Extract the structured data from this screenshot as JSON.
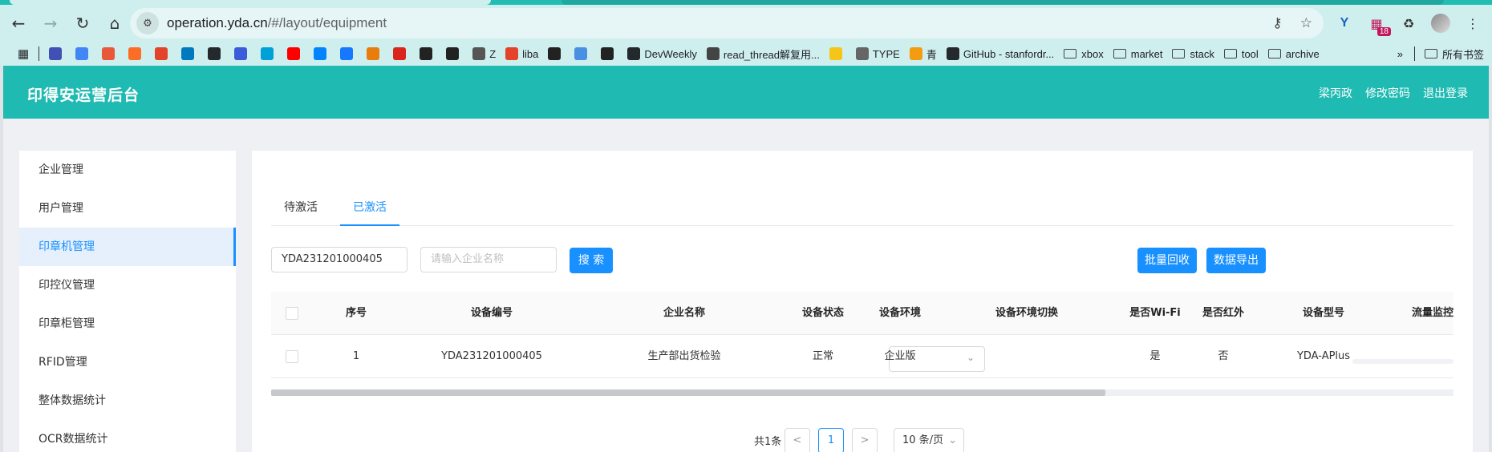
{
  "browser": {
    "url_host": "operation.yda.cn",
    "url_path": "/#/layout/equipment",
    "extension_badge": "18",
    "bookmarks": [
      {
        "label": "",
        "color": "#3f51b5"
      },
      {
        "label": "",
        "color": "#4285f4"
      },
      {
        "label": "",
        "color": "#e8593a"
      },
      {
        "label": "",
        "color": "#fc6d26"
      },
      {
        "label": "",
        "color": "#e24329"
      },
      {
        "label": "",
        "color": "#0079bf"
      },
      {
        "label": "",
        "color": "#24292e"
      },
      {
        "label": "",
        "color": "#3b5bdb"
      },
      {
        "label": "",
        "color": "#00a1d6"
      },
      {
        "label": "",
        "color": "#ff0000"
      },
      {
        "label": "",
        "color": "#0084ff"
      },
      {
        "label": "",
        "color": "#1677ff"
      },
      {
        "label": "",
        "color": "#e87d0d"
      },
      {
        "label": "",
        "color": "#d9251c"
      },
      {
        "label": "",
        "color": "#222222"
      },
      {
        "label": "",
        "color": "#222222"
      },
      {
        "label": "Z",
        "color": "#555555"
      },
      {
        "label": "liba",
        "color": "#e24329"
      },
      {
        "label": "",
        "color": "#222222"
      },
      {
        "label": "",
        "color": "#4a90e2"
      },
      {
        "label": "",
        "color": "#222222"
      },
      {
        "label": "DevWeekly",
        "color": "#24292e"
      },
      {
        "label": "read_thread解复用...",
        "color": "#444444"
      },
      {
        "label": "",
        "color": "#f5c518"
      },
      {
        "label": "TYPE",
        "color": "#666666"
      },
      {
        "label": "青",
        "color": "#f39c12"
      },
      {
        "label": "GitHub - stanfordr...",
        "color": "#24292e"
      }
    ],
    "bookmark_folders": [
      "xbox",
      "market",
      "stack",
      "tool",
      "archive"
    ],
    "all_bookmarks_label": "所有书签"
  },
  "header": {
    "title": "印得安运营后台",
    "user_name": "梁丙政",
    "change_password": "修改密码",
    "logout": "退出登录"
  },
  "sidebar": {
    "items": [
      {
        "label": "企业管理",
        "active": false
      },
      {
        "label": "用户管理",
        "active": false
      },
      {
        "label": "印章机管理",
        "active": true
      },
      {
        "label": "印控仪管理",
        "active": false
      },
      {
        "label": "印章柜管理",
        "active": false
      },
      {
        "label": "RFID管理",
        "active": false
      },
      {
        "label": "整体数据统计",
        "active": false
      },
      {
        "label": "OCR数据统计",
        "active": false
      }
    ]
  },
  "tabs": [
    {
      "label": "待激活",
      "active": false
    },
    {
      "label": "已激活",
      "active": true
    }
  ],
  "filters": {
    "device_no_value": "YDA231201000405",
    "company_placeholder": "请输入企业名称",
    "search_label": "搜 索",
    "batch_recycle_label": "批量回收",
    "export_label": "数据导出"
  },
  "table": {
    "columns": [
      "序号",
      "设备编号",
      "企业名称",
      "设备状态",
      "设备环境",
      "设备环境切换",
      "是否Wi-Fi",
      "是否红外",
      "设备型号",
      "流量监控"
    ],
    "rows": [
      {
        "index": "1",
        "device_no": "YDA231201000405",
        "company": "生产部出货检验",
        "status": "正常",
        "env": "企业版",
        "env_switch": "",
        "wifi": "是",
        "infrared": "否",
        "model": "YDA-APlus"
      }
    ]
  },
  "pagination": {
    "total": "共1条",
    "prev": "<",
    "current": "1",
    "next": ">",
    "page_size": "10 条/页"
  },
  "colors": {
    "accent": "#1890ff",
    "header_bg": "#1fbab2"
  }
}
